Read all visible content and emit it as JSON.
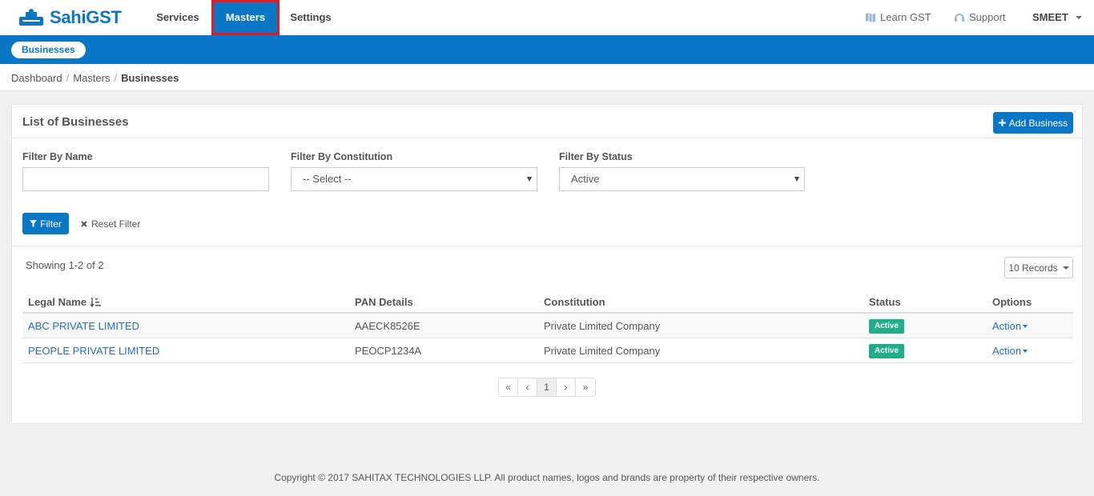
{
  "brand": {
    "name": "SahiGST",
    "color": "#0a77c6"
  },
  "nav": {
    "items": [
      {
        "label": "Services"
      },
      {
        "label": "Masters"
      },
      {
        "label": "Settings"
      }
    ],
    "learn_label": "Learn GST",
    "support_label": "Support",
    "user_label": "SMEET",
    "highlight_color": "#e01b24"
  },
  "subnav": {
    "pill_label": "Businesses"
  },
  "breadcrumb": {
    "items": [
      "Dashboard",
      "Masters",
      "Businesses"
    ]
  },
  "panel": {
    "title": "List of Businesses",
    "add_button_label": "Add Business"
  },
  "filters": {
    "name_label": "Filter By Name",
    "name_value": "",
    "constitution_label": "Filter By Constitution",
    "constitution_value": "-- Select --",
    "status_label": "Filter By Status",
    "status_value": "Active",
    "filter_button_label": "Filter",
    "reset_label": "Reset Filter"
  },
  "list": {
    "showing_text": "Showing 1-2 of 2",
    "records_label": "10 Records",
    "columns": [
      "Legal Name",
      "PAN Details",
      "Constitution",
      "Status",
      "Options"
    ],
    "rows": [
      {
        "legal_name": "ABC PRIVATE LIMITED",
        "pan": "AAECK8526E",
        "constitution": "Private Limited Company",
        "status": "Active",
        "option": "Action"
      },
      {
        "legal_name": "PEOPLE PRIVATE LIMITED",
        "pan": "PEOCP1234A",
        "constitution": "Private Limited Company",
        "status": "Active",
        "option": "Action"
      }
    ],
    "status_color": "#1fae8a"
  },
  "pagination": {
    "first": "«",
    "prev": "‹",
    "current": "1",
    "next": "›",
    "last": "»"
  },
  "footer": {
    "text": "Copyright © 2017 SAHITAX TECHNOLOGIES LLP. All product names, logos and brands are property of their respective owners."
  }
}
